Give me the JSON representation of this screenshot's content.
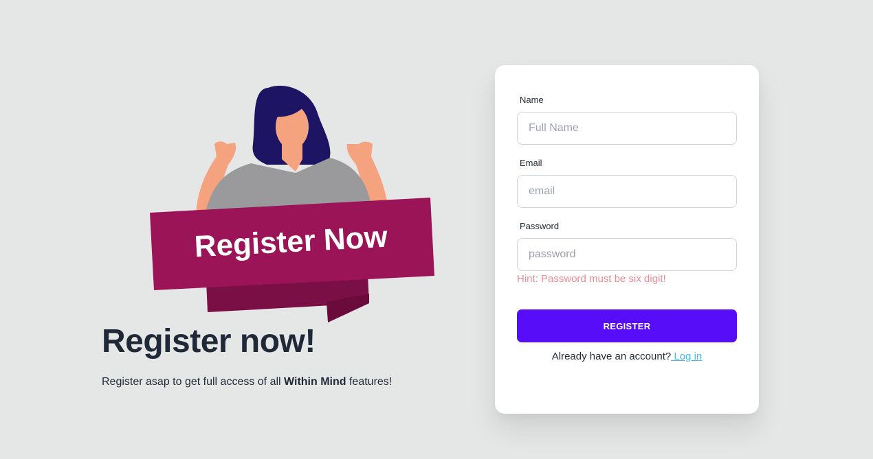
{
  "hero": {
    "banner_text": "Register Now",
    "title": "Register now!",
    "subtitle_prefix": "Register asap to get full access of all ",
    "subtitle_brand": "Within Mind",
    "subtitle_suffix": " features!"
  },
  "form": {
    "name": {
      "label": "Name",
      "placeholder": "Full Name",
      "value": ""
    },
    "email": {
      "label": "Email",
      "placeholder": "email",
      "value": ""
    },
    "password": {
      "label": "Password",
      "placeholder": "password",
      "value": ""
    },
    "hint": "Hint: Password must be six digit!",
    "submit_label": "REGISTER",
    "account_prompt": "Already have an account?",
    "login_link": " Log in"
  },
  "colors": {
    "background": "#e5e7e6",
    "primary": "#570df8",
    "banner": "#9b1458",
    "hint": "#f08a96",
    "link": "#3abff8"
  }
}
